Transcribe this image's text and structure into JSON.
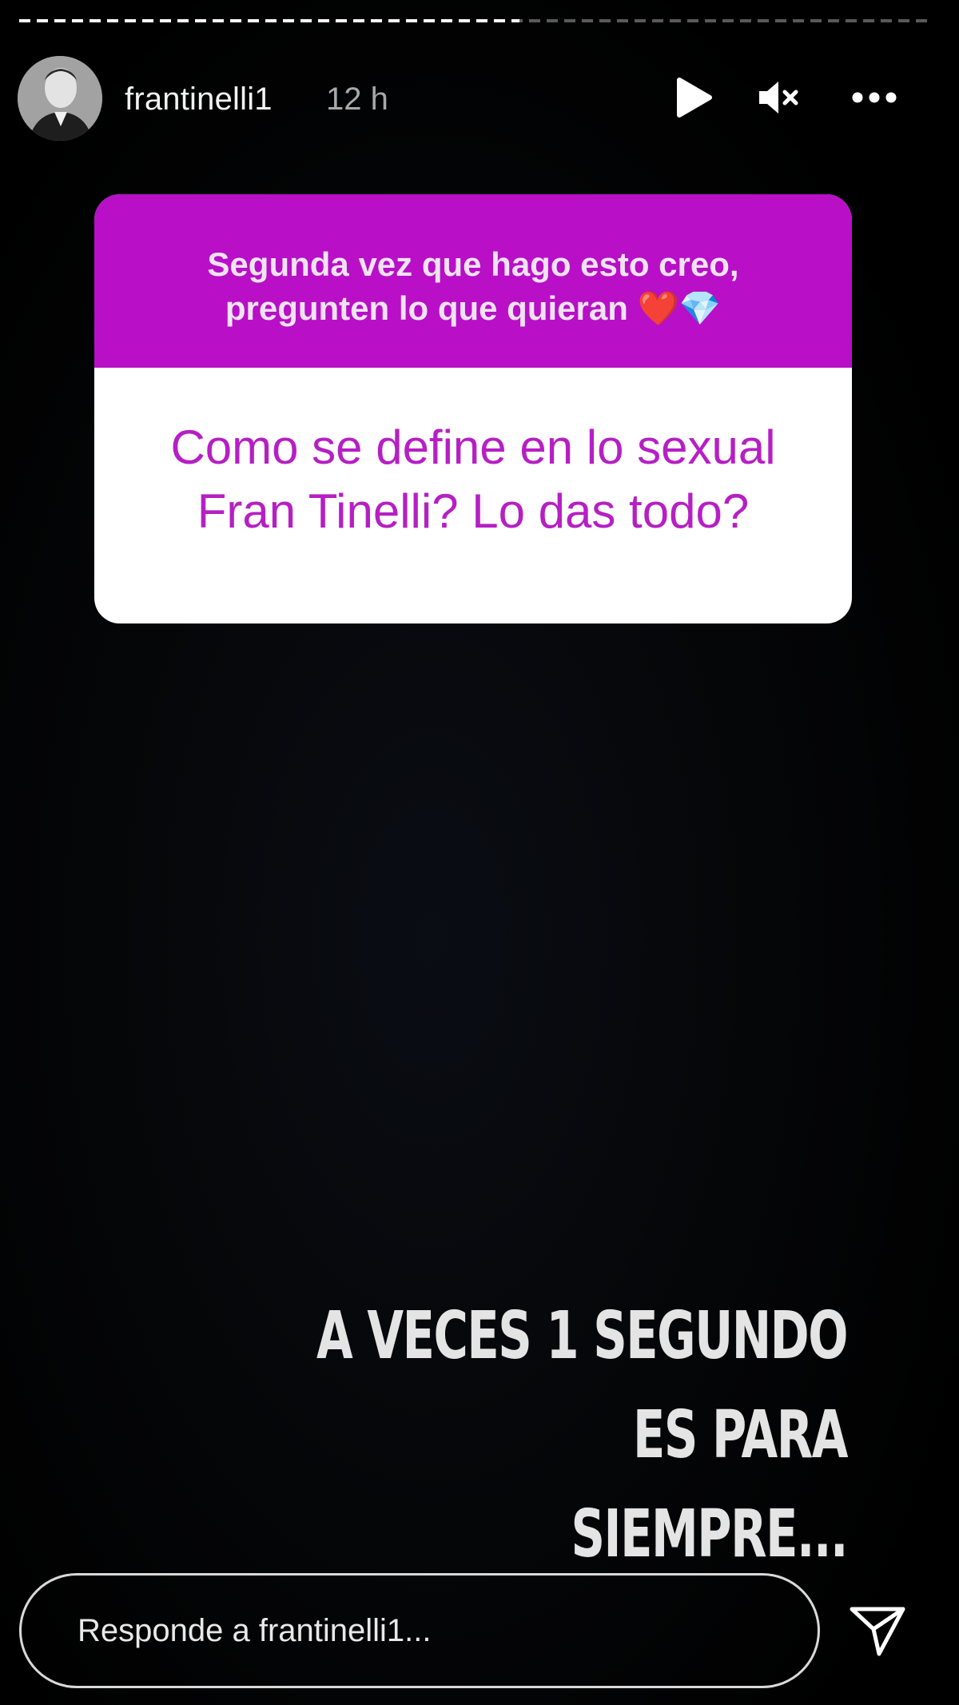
{
  "story": {
    "progress_fraction": 0.55
  },
  "header": {
    "username": "frantinelli1",
    "timestamp": "12 h"
  },
  "icons": {
    "play": "play-icon",
    "mute": "speaker-muted-icon",
    "more": "more-options-icon",
    "send": "send-icon"
  },
  "question_sticker": {
    "prompt": "Segunda vez que hago esto creo, pregunten lo que quieran ❤️💎",
    "question": "Como se define en lo sexual Fran Tinelli? Lo das todo?",
    "header_color": "#b80fc7",
    "question_color": "#b61fc4"
  },
  "caption": {
    "line1": "A VECES 1 SEGUNDO ES PARA",
    "line2": "SIEMPRE..."
  },
  "reply": {
    "placeholder": "Responde a frantinelli1..."
  }
}
